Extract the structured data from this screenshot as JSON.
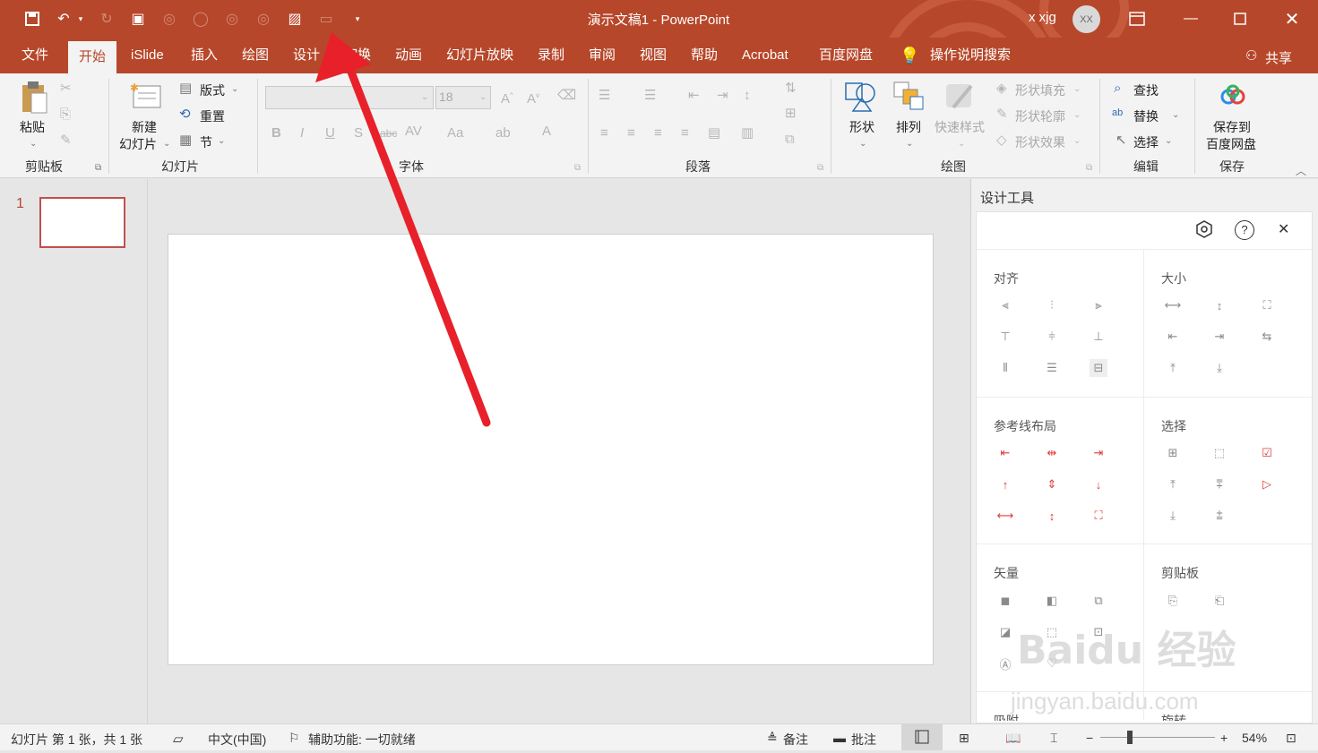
{
  "title_bar": {
    "doc_title": "演示文稿1  -  PowerPoint",
    "user_name": "x xjg",
    "avatar_initials": "XX"
  },
  "tabs": [
    "文件",
    "开始",
    "iSlide",
    "插入",
    "绘图",
    "设计",
    "切换",
    "动画",
    "幻灯片放映",
    "录制",
    "审阅",
    "视图",
    "帮助",
    "Acrobat",
    "百度网盘"
  ],
  "tell_me": "操作说明搜索",
  "share_label": "共享",
  "ribbon": {
    "clipboard": {
      "paste": "粘贴",
      "group": "剪贴板"
    },
    "slides": {
      "new_slide_1": "新建",
      "new_slide_2": "幻灯片",
      "layout": "版式",
      "reset": "重置",
      "section": "节",
      "group": "幻灯片"
    },
    "font": {
      "size": "18",
      "group": "字体"
    },
    "paragraph": {
      "group": "段落"
    },
    "drawing": {
      "shapes": "形状",
      "arrange": "排列",
      "quick_styles": "快速样式",
      "shape_fill": "形状填充",
      "shape_outline": "形状轮廓",
      "shape_effects": "形状效果",
      "group": "绘图"
    },
    "editing": {
      "find": "查找",
      "replace": "替换",
      "select": "选择",
      "group": "编辑"
    },
    "save": {
      "line1": "保存到",
      "line2": "百度网盘",
      "group": "保存"
    }
  },
  "slide_number": "1",
  "design_panel": {
    "title": "设计工具",
    "sections": {
      "align": "对齐",
      "size": "大小",
      "guides": "参考线布局",
      "select": "选择",
      "vector": "矢量",
      "clipboard": "剪贴板",
      "cut1": "吸附",
      "cut2": "旋转"
    }
  },
  "status_bar": {
    "slide_info": "幻灯片 第 1 张，共 1 张",
    "language": "中文(中国)",
    "accessibility": "辅助功能: 一切就绪",
    "notes": "备注",
    "comments": "批注",
    "zoom": "54%"
  },
  "watermark": {
    "brand": "Baidu 经验",
    "url": "jingyan.baidu.com"
  },
  "colors": {
    "accent": "#b7472a",
    "arrow": "#e8202a",
    "guide_icons": "#e03c3c"
  }
}
